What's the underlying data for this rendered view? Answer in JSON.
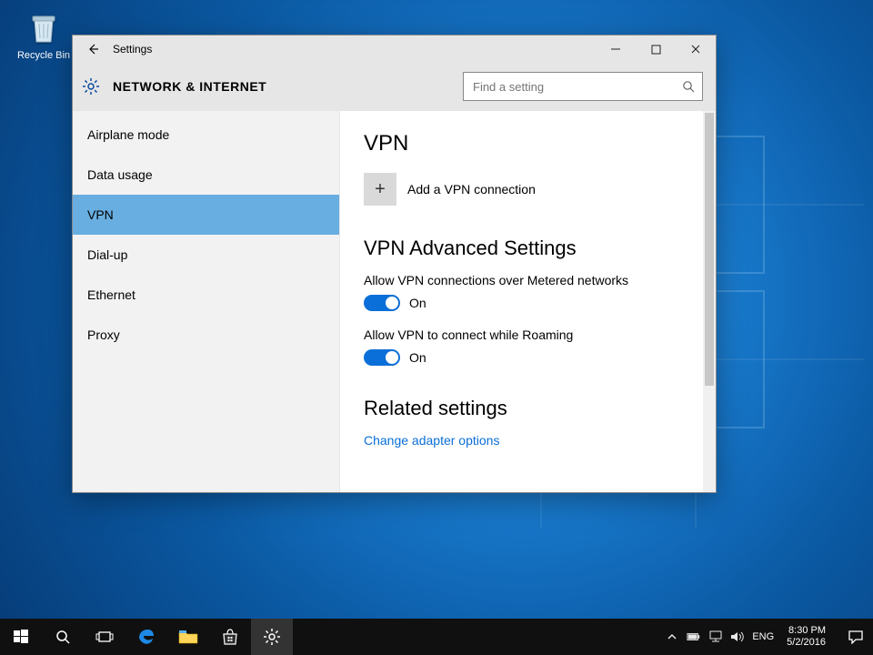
{
  "desktop": {
    "recycle_bin": "Recycle Bin"
  },
  "window": {
    "title": "Settings"
  },
  "header": {
    "title": "NETWORK & INTERNET",
    "search_placeholder": "Find a setting"
  },
  "sidebar": {
    "items": [
      {
        "label": "Airplane mode",
        "selected": false
      },
      {
        "label": "Data usage",
        "selected": false
      },
      {
        "label": "VPN",
        "selected": true
      },
      {
        "label": "Dial-up",
        "selected": false
      },
      {
        "label": "Ethernet",
        "selected": false
      },
      {
        "label": "Proxy",
        "selected": false
      }
    ]
  },
  "main": {
    "heading_vpn": "VPN",
    "add_vpn_label": "Add a VPN connection",
    "heading_advanced": "VPN Advanced Settings",
    "metered_label": "Allow VPN connections over Metered networks",
    "metered_state": "On",
    "roaming_label": "Allow VPN to connect while Roaming",
    "roaming_state": "On",
    "heading_related": "Related settings",
    "link_adapter": "Change adapter options"
  },
  "taskbar": {
    "tray_lang": "ENG",
    "clock_time": "8:30 PM",
    "clock_date": "5/2/2016"
  }
}
